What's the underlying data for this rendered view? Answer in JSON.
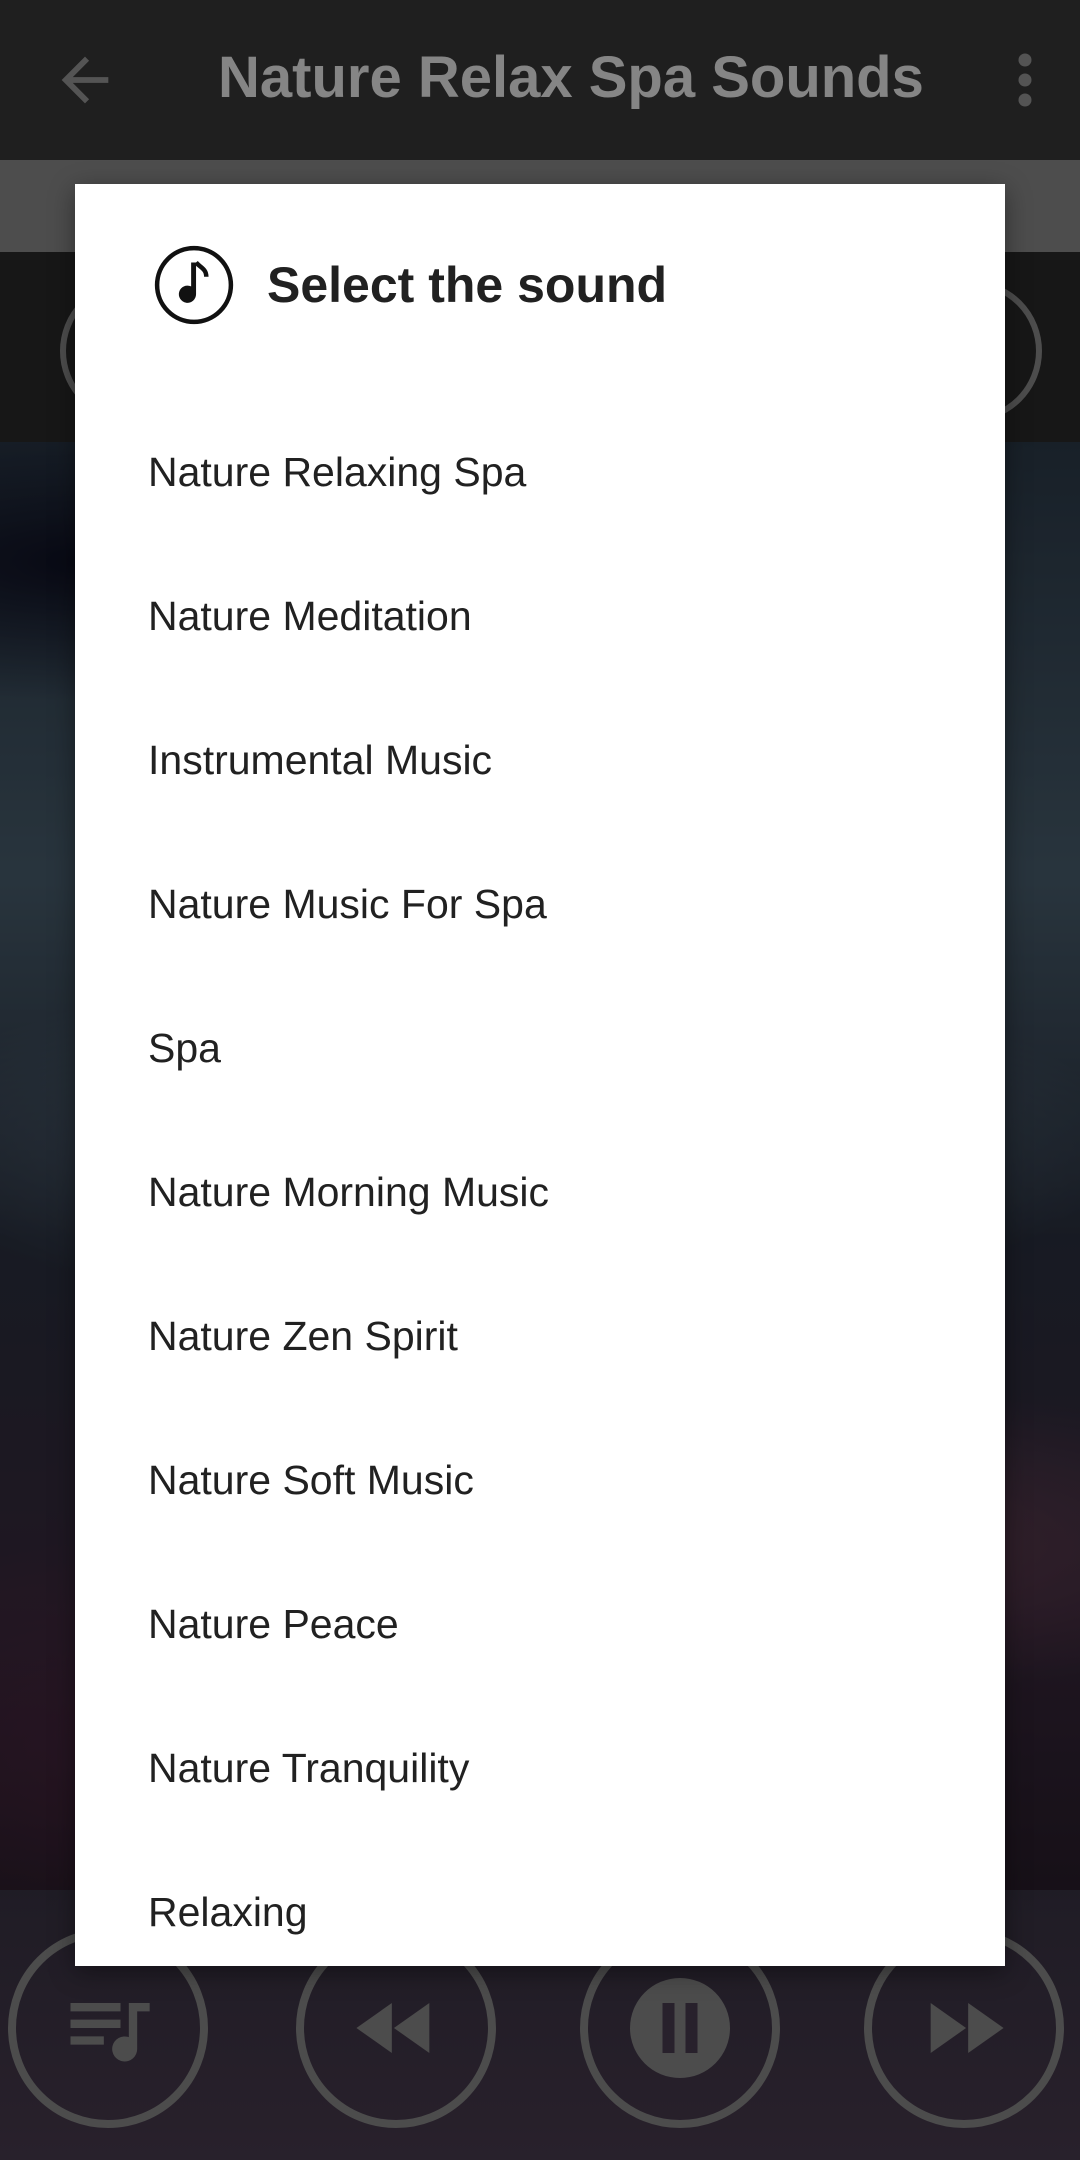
{
  "app_bar": {
    "title": "Nature Relax Spa Sounds"
  },
  "dialog": {
    "title": "Select the sound",
    "items": [
      "Nature Relaxing Spa",
      "Nature Meditation",
      "Instrumental Music",
      "Nature Music For Spa",
      "Spa",
      "Nature Morning Music",
      "Nature Zen Spirit",
      "Nature Soft Music",
      "Nature Peace",
      "Nature Tranquility",
      "Relaxing"
    ]
  },
  "icons": {
    "back": "arrow-left-icon",
    "more": "more-vertical-icon",
    "dialog": "music-note-icon",
    "playlist": "playlist-icon",
    "rewind": "rewind-icon",
    "pause": "pause-icon",
    "fast_forward": "fast-forward-icon"
  },
  "colors": {
    "app_bar": "#3a3a3a",
    "dialog_bg": "#ffffff",
    "text": "#212121"
  }
}
